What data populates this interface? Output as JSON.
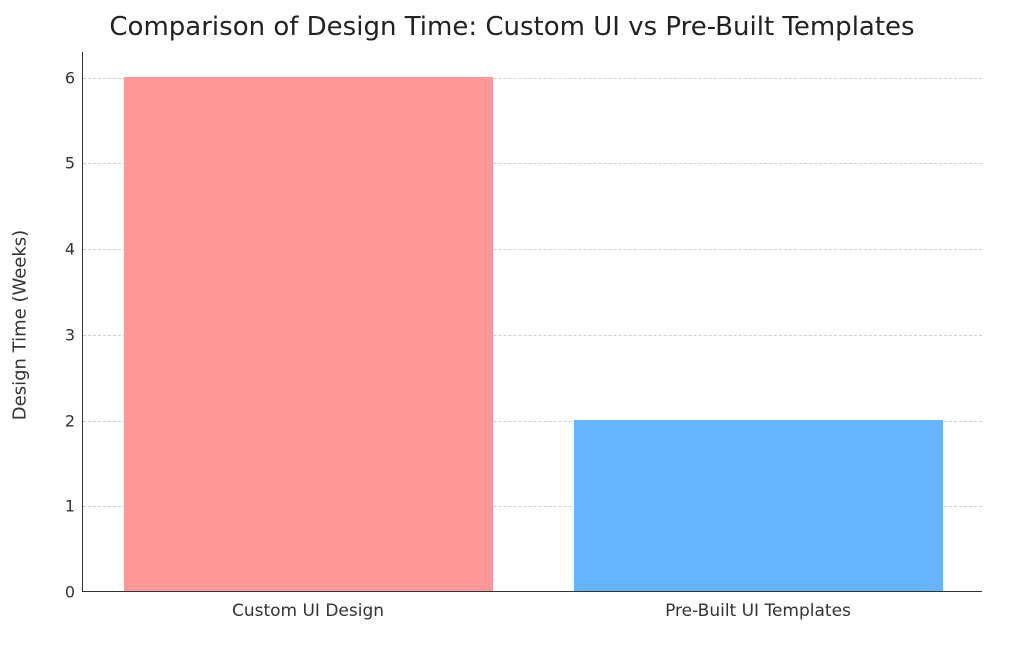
{
  "chart_data": {
    "type": "bar",
    "title": "Comparison of Design Time: Custom UI vs Pre-Built Templates",
    "xlabel": "",
    "ylabel": "Design Time (Weeks)",
    "categories": [
      "Custom UI Design",
      "Pre-Built UI Templates"
    ],
    "values": [
      6,
      2
    ],
    "ylim": [
      0,
      6.3
    ],
    "yticks": [
      0,
      1,
      2,
      3,
      4,
      5,
      6
    ],
    "colors": [
      "#ff9999",
      "#66b3ff"
    ]
  }
}
